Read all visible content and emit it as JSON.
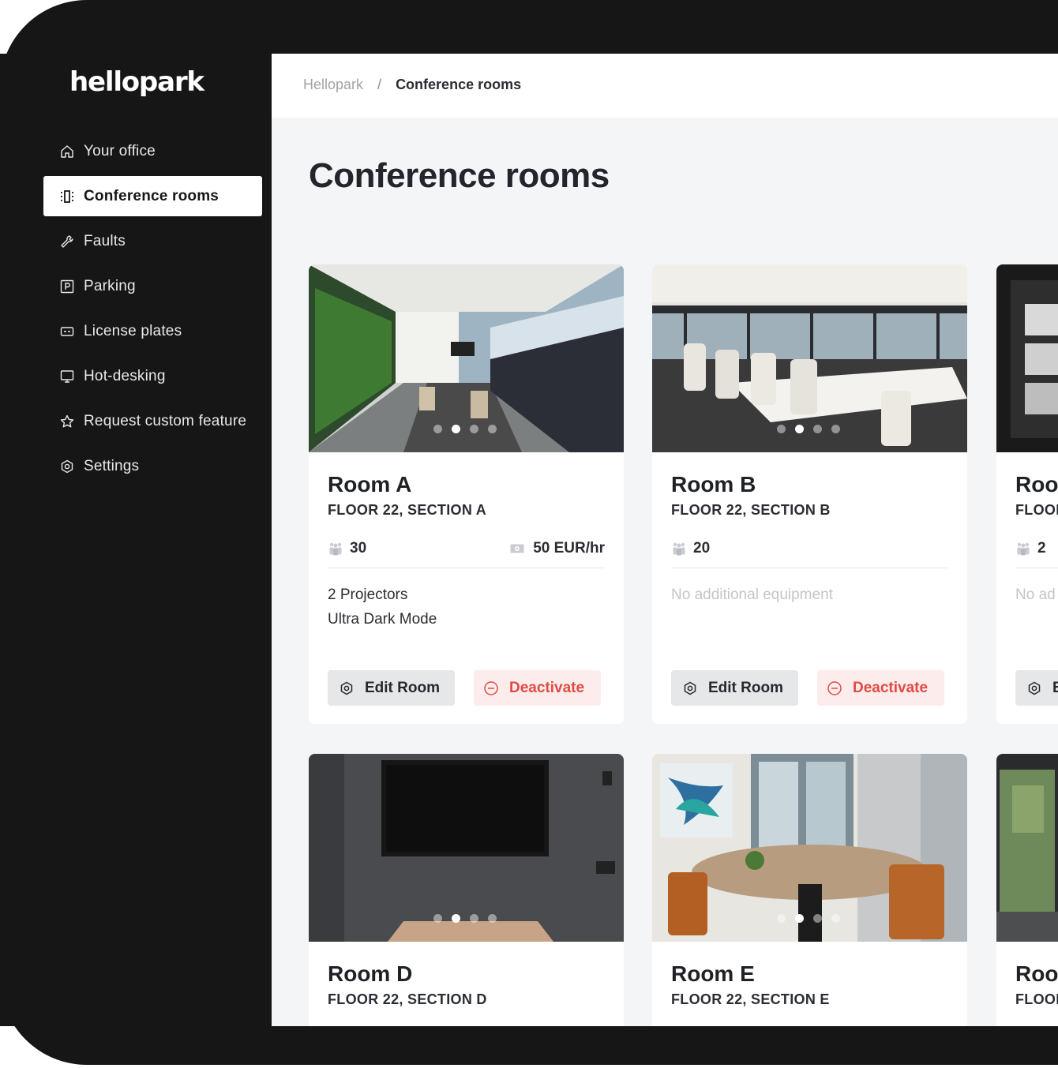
{
  "app": {
    "logo": "hellopark"
  },
  "sidebar": {
    "items": [
      {
        "label": "Your office",
        "icon": "home-icon",
        "active": false
      },
      {
        "label": "Conference rooms",
        "icon": "conference-icon",
        "active": true
      },
      {
        "label": "Faults",
        "icon": "wrench-icon",
        "active": false
      },
      {
        "label": "Parking",
        "icon": "parking-icon",
        "active": false
      },
      {
        "label": "License plates",
        "icon": "license-plate-icon",
        "active": false
      },
      {
        "label": "Hot-desking",
        "icon": "monitor-icon",
        "active": false
      },
      {
        "label": "Request custom feature",
        "icon": "star-icon",
        "active": false
      },
      {
        "label": "Settings",
        "icon": "settings-icon",
        "active": false
      }
    ]
  },
  "breadcrumb": {
    "root": "Hellopark",
    "separator": "/",
    "current": "Conference rooms"
  },
  "page": {
    "title": "Conference rooms"
  },
  "buttons": {
    "edit": "Edit Room",
    "deactivate": "Deactivate"
  },
  "rooms": [
    {
      "name": "Room A",
      "floor": "FLOOR 22, SECTION A",
      "capacity": "30",
      "price": "50 EUR/hr",
      "equipment": [
        "2 Projectors",
        "Ultra Dark Mode"
      ]
    },
    {
      "name": "Room B",
      "floor": "FLOOR 22, SECTION B",
      "capacity": "20",
      "equipment_empty": "No additional equipment"
    },
    {
      "name": "Room",
      "floor": "FLOOR",
      "capacity": "2",
      "equipment_empty": "No ad",
      "edit_label": "E"
    },
    {
      "name": "Room D",
      "floor": "FLOOR 22, SECTION D"
    },
    {
      "name": "Room E",
      "floor": "FLOOR 22, SECTION E"
    },
    {
      "name": "Room",
      "floor": "FLOOR"
    }
  ],
  "colors": {
    "sidebar": "#161616",
    "main_bg": "#f4f5f7",
    "danger": "#e04b43",
    "danger_bg": "#fdecec"
  }
}
